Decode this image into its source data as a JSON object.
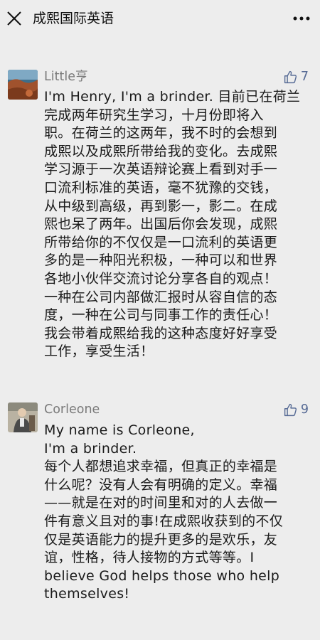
{
  "header": {
    "title": "成熙国际英语",
    "close_icon": "close-icon",
    "more_icon": "more-icon"
  },
  "comments": [
    {
      "name": "Little亨",
      "likes": "7",
      "avatar_icon": "avatar-landscape",
      "content": "I'm Henry, I'm a brinder. 目前已在荷兰\n完成两年研究生学习，十月份即将入\n职。在荷兰的这两年，我不时的会想到\n成熙以及成熙所带给我的变化。去成熙\n学习源于一次英语辩论赛上看到对手一\n口流利标准的英语，毫不犹豫的交钱，\n从中级到高级，再到影一，影二。在成\n熙也呆了两年。出国后你会发现，成熙\n所带给你的不仅仅是一口流利的英语更\n多的是一种阳光积极，一种可以和世界\n各地小伙伴交流讨论分享各自的观点！\n一种在公司内部做汇报时从容自信的态\n度，一种在公司与同事工作的责任心！\n我会带着成熙给我的这种态度好好享受\n工作，享受生活！"
    },
    {
      "name": "Corleone",
      "likes": "9",
      "avatar_icon": "avatar-person",
      "content": "My name is Corleone,\nI'm a brinder.\n每个人都想追求幸福，但真正的幸福是\n什么呢？没有人会有明确的定义。幸福\n——就是在对的时间里和对的人去做一\n件有意义且对的事!在成熙收获到的不仅\n仅是英语能力的提升更多的是欢乐，友\n谊，性格，待人接物的方式等等。I\nbelieve God helps those who help\nthemselves!"
    }
  ],
  "colors": {
    "background": "#ededed",
    "link_blue": "#576b95",
    "name_gray": "#7a7a7a"
  }
}
